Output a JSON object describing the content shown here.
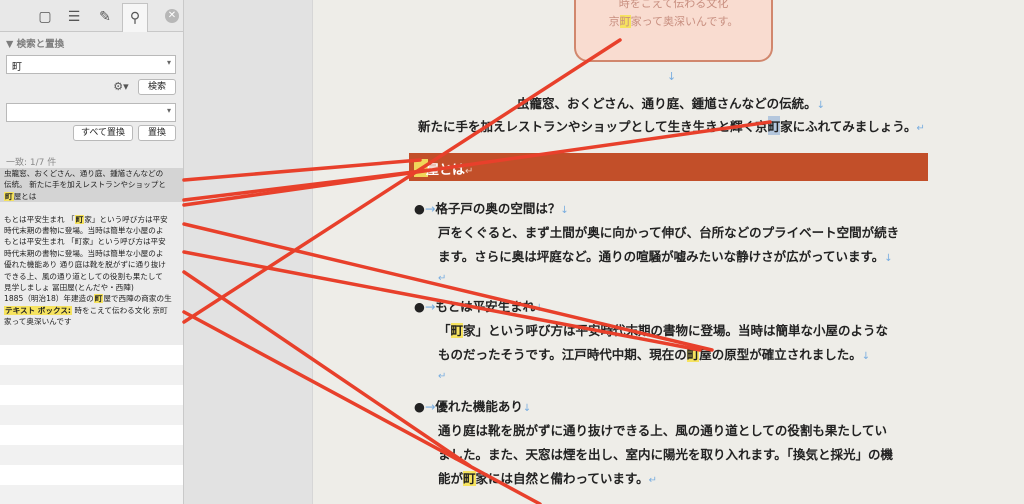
{
  "sidebar": {
    "panel_title": "▼ 検索と置換",
    "search_value": "町",
    "search_button": "検索",
    "replace_value": "",
    "replace_all_button": "すべて置換",
    "replace_button": "置換",
    "result_count": "一致: 1/7 件",
    "results": [
      {
        "pre": "虫籠窓、おくどさん、通り庭、鍾馗さんなどの",
        "hit": "",
        "post": ""
      },
      {
        "pre": "伝統。 新たに手を加えレストランやショップと",
        "hit": "",
        "post": ""
      },
      {
        "pre": "",
        "hit": "町",
        "post": "屋とは"
      },
      {
        "pre": "",
        "hit": "",
        "post": ""
      },
      {
        "pre": "もとは平安生まれ 「",
        "hit": "町",
        "post": "家」という呼び方は平安"
      },
      {
        "pre": "時代末期の書物に登場。当時は簡単な小屋のよ",
        "hit": "",
        "post": ""
      },
      {
        "pre": "もとは平安生まれ 「町家」という呼び方は平安",
        "hit": "",
        "post": ""
      },
      {
        "pre": "時代末期の書物に登場。当時は簡単な小屋のよ",
        "hit": "",
        "post": ""
      },
      {
        "pre": "優れた機能あり 通り庭は靴を脱がずに通り抜け",
        "hit": "",
        "post": ""
      },
      {
        "pre": "できる上、風の通り道としての役割も果たして",
        "hit": "",
        "post": ""
      },
      {
        "pre": "見学しましょ 冨田屋(とんだや・西陣)",
        "hit": "",
        "post": ""
      },
      {
        "pre": "1885（明治18）年建造の",
        "hit": "町",
        "post": "屋で西陣の商家の生"
      },
      {
        "pre": "",
        "hit": "テキスト ボックス:",
        "post": " 時をこえて伝わる文化 京町"
      },
      {
        "pre": "家って奥深いんです",
        "hit": "",
        "post": ""
      }
    ]
  },
  "document": {
    "callout_line1": "時をこえて伝わる文化",
    "callout_line2_pre": "京",
    "callout_line2_hit": "町",
    "callout_line2_post": "家って奥深いんです。",
    "intro_line1": "虫籠窓、おくどさん、通り庭、鍾馗さんなどの伝統。",
    "intro_line2_pre": "新たに手を加えレストランやショップとして生き生きと輝く京",
    "intro_line2_hit": "町",
    "intro_line2_post": "家にふれてみましょう。",
    "heading": "屋とは",
    "section1_title": "格子戸の奥の空間は？",
    "section1_body1": "戸をくぐると、まず土間が奥に向かって伸び、台所などのプライベート空間が続き",
    "section1_body2": "ます。さらに奥は坪庭など。通りの喧騒が嘘みたいな静けさが広がっています。",
    "section2_title": "もとは平安生まれ",
    "section2_body1_pre": "「",
    "section2_body1_hit": "町",
    "section2_body1_post": "家」という呼び方は平安時代末期の書物に登場。当時は簡単な小屋のような",
    "section2_body2_pre": "ものだったそうです。江戸時代中期、現在の",
    "section2_body2_hit": "町",
    "section2_body2_post": "屋の原型が確立されました。",
    "section3_title": "優れた機能あり",
    "section3_body1": "通り庭は靴を脱がずに通り抜けできる上、風の通り道としての役割も果たしてい",
    "section3_body2": "ました。また、天窓は煙を出し、室内に陽光を取り入れます。「換気と採光」の機",
    "section3_body3_pre": "能が",
    "section3_body3_hit": "町",
    "section3_body3_post": "家には自然と備わっています。"
  },
  "colors": {
    "heading_bar": "#c24f29",
    "highlight": "#f6e35f",
    "connector_line": "#e8402b",
    "callout_fill": "#f9dcd0"
  }
}
